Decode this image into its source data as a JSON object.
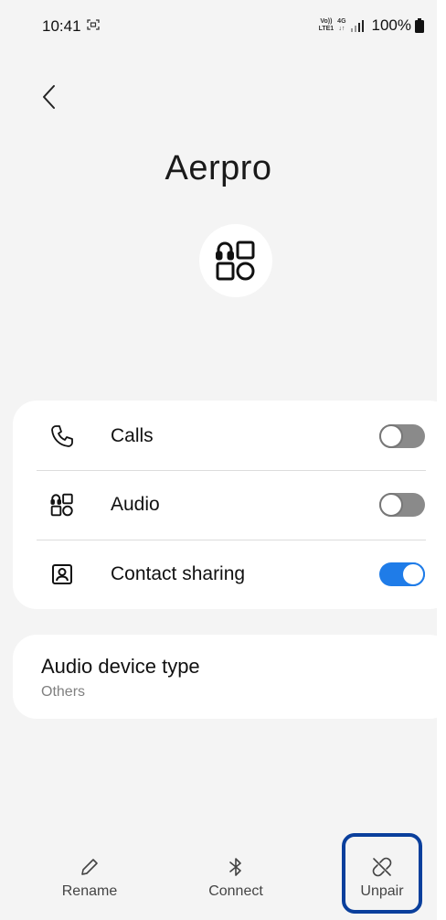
{
  "status_bar": {
    "time": "10:41",
    "volte_top": "Vo))",
    "volte_bottom": "LTE1",
    "network": "4G",
    "battery": "100%"
  },
  "device": {
    "name": "Aerpro",
    "icon": "devices-icon"
  },
  "settings": [
    {
      "label": "Calls",
      "icon": "phone-icon",
      "enabled": false
    },
    {
      "label": "Audio",
      "icon": "devices-icon",
      "enabled": false
    },
    {
      "label": "Contact sharing",
      "icon": "contact-icon",
      "enabled": true
    }
  ],
  "audio_type": {
    "title": "Audio device type",
    "value": "Others"
  },
  "actions": {
    "rename": "Rename",
    "connect": "Connect",
    "unpair": "Unpair"
  },
  "colors": {
    "accent": "#1f7ce8",
    "highlight": "#0a3f9c",
    "background": "#f4f4f4"
  }
}
